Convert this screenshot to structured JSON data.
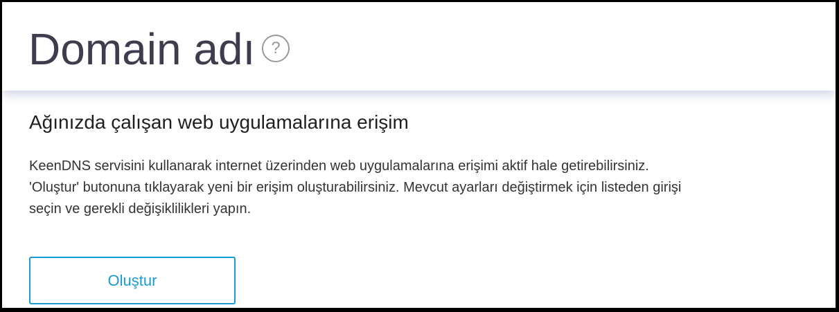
{
  "header": {
    "title": "Domain adı",
    "help_icon": "question-circle-icon",
    "help_glyph": "?"
  },
  "main": {
    "section_title": "Ağınızda çalışan web uygulamalarına erişim",
    "description_lines": [
      "KeenDNS servisini kullanarak internet üzerinden web uygulamalarına erişimi aktif hale getirebilirsiniz.",
      "'Oluştur' butonuna tıklayarak yeni bir erişim oluşturabilirsiniz. Mevcut ayarları değiştirmek için listeden girişi",
      "seçin ve gerekli değişiklilikleri yapın."
    ],
    "create_button_label": "Oluştur"
  },
  "colors": {
    "accent": "#1a9ad6",
    "title_text": "#3d3d4e",
    "body_text": "#333333",
    "help_icon": "#9a9a9a"
  }
}
